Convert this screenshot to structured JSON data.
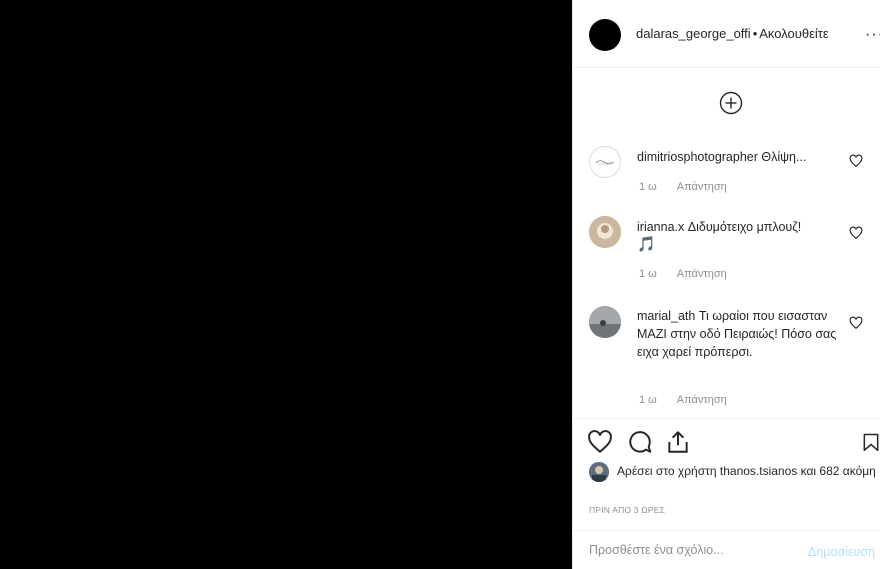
{
  "header": {
    "username": "dalaras_george_offi",
    "separator": "•",
    "follow_label": "Ακολουθείτε",
    "more": "···"
  },
  "comments": [
    {
      "username": "dimitriosphotographer",
      "text": "Θλίψη...",
      "time": "1 ω",
      "reply": "Απάντηση"
    },
    {
      "username": "irianna.x",
      "text": "Διδυμότειχο μπλουζ!",
      "emoji": "🎵",
      "time": "1 ω",
      "reply": "Απάντηση"
    },
    {
      "username": "marial_ath",
      "text": "Τι ωραίοι που εισασταν ΜΑΖΙ στην οδό Πειραιώς! Πόσο σας ειχα χαρεί πρόπερσι.",
      "time": "1 ω",
      "reply": "Απάντηση"
    }
  ],
  "likes": {
    "prefix": "Αρέσει στο χρήστη",
    "user": "thanos.tsianos",
    "suffix": "και 682 ακόμη"
  },
  "timestamp": "ΠΡΙΝ ΑΠΟ 3 ΩΡΕΣ",
  "add_comment": {
    "placeholder": "Προσθέστε ένα σχόλιο...",
    "post_label": "Δημοσίευση"
  }
}
